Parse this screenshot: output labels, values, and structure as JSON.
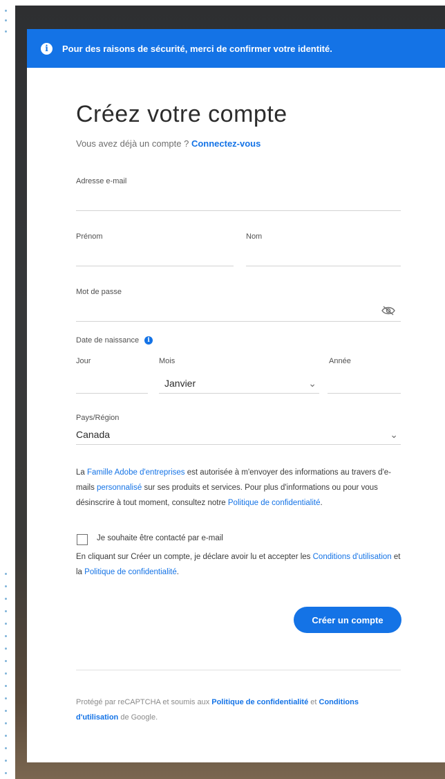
{
  "banner": {
    "text": "Pour des raisons de sécurité, merci de confirmer votre identité."
  },
  "form": {
    "title": "Créez votre compte",
    "subtitle_prefix": "Vous avez déjà un compte ? ",
    "subtitle_link": "Connectez-vous",
    "email_label": "Adresse e-mail",
    "email_value": "",
    "firstname_label": "Prénom",
    "firstname_value": "",
    "lastname_label": "Nom",
    "lastname_value": "",
    "password_label": "Mot de passe",
    "password_value": "",
    "birthdate_label": "Date de naissance",
    "day_label": "Jour",
    "day_value": "",
    "month_label": "Mois",
    "month_value": "Janvier",
    "year_label": "Année",
    "year_value": "",
    "country_label": "Pays/Région",
    "country_value": "Canada"
  },
  "consent": {
    "p1_a": "La ",
    "p1_link1": "Famille Adobe d'entreprises",
    "p1_b": " est autorisée à m'envoyer des informations au travers d'e-mails ",
    "p1_link2": "personnalisé",
    "p1_c": " sur ses produits et services. Pour plus d'informations ou pour vous désinscrire à tout moment, consultez notre ",
    "p1_link3": "Politique de confidentialité",
    "p1_d": ".",
    "checkbox_label": "Je souhaite être contacté par e-mail",
    "p2_a": "En cliquant sur Créer un compte, je déclare avoir lu et accepter les ",
    "p2_link1": "Conditions d'utilisation",
    "p2_b": " et la ",
    "p2_link2": "Politique de confidentialité",
    "p2_c": "."
  },
  "cta": {
    "label": "Créer un compte"
  },
  "recaptcha": {
    "a": "Protégé par reCAPTCHA et soumis aux ",
    "link1": "Politique de confidentialité",
    "b": " et ",
    "link2": "Conditions d'utilisation",
    "c": " de Google."
  },
  "icons": {
    "info": "info-icon",
    "eye": "eye-slash-icon",
    "chevron": "chevron-down-icon"
  },
  "colors": {
    "accent": "#1473e6",
    "text": "#2c2c2c"
  }
}
